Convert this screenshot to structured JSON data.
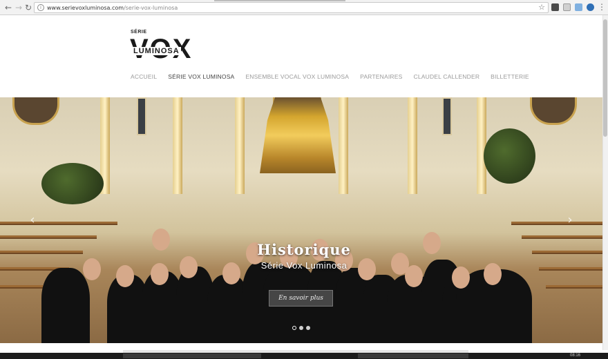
{
  "browser": {
    "url_host": "www.serievoxluminosa.com",
    "url_path": "/serie-vox-luminosa",
    "icons": [
      "back-icon",
      "forward-icon",
      "reload-icon",
      "info-icon",
      "bookmark-star-icon"
    ]
  },
  "logo": {
    "serie": "SÉRIE",
    "vox": "VOX",
    "luminosa": "LUMINOSA"
  },
  "nav": {
    "items": [
      {
        "label": "ACCUEIL"
      },
      {
        "label": "SÉRIE VOX LUMINOSA"
      },
      {
        "label": "ENSEMBLE VOCAL VOX LUMINOSA"
      },
      {
        "label": "PARTENAIRES"
      },
      {
        "label": "CLAUDEL CALLENDER"
      },
      {
        "label": "BILLETTERIE"
      }
    ],
    "active_index": 1
  },
  "hero": {
    "title": "Historique",
    "subtitle": "Série Vox Luminosa",
    "button_label": "En savoir plus",
    "prev_icon": "‹",
    "next_icon": "›",
    "slide_count": 3,
    "active_slide": 1
  },
  "taskbar": {
    "time": "08:16"
  },
  "colors": {
    "nav_inactive": "#9a9a9a",
    "nav_active": "#444444",
    "button_bg": "#505050"
  }
}
